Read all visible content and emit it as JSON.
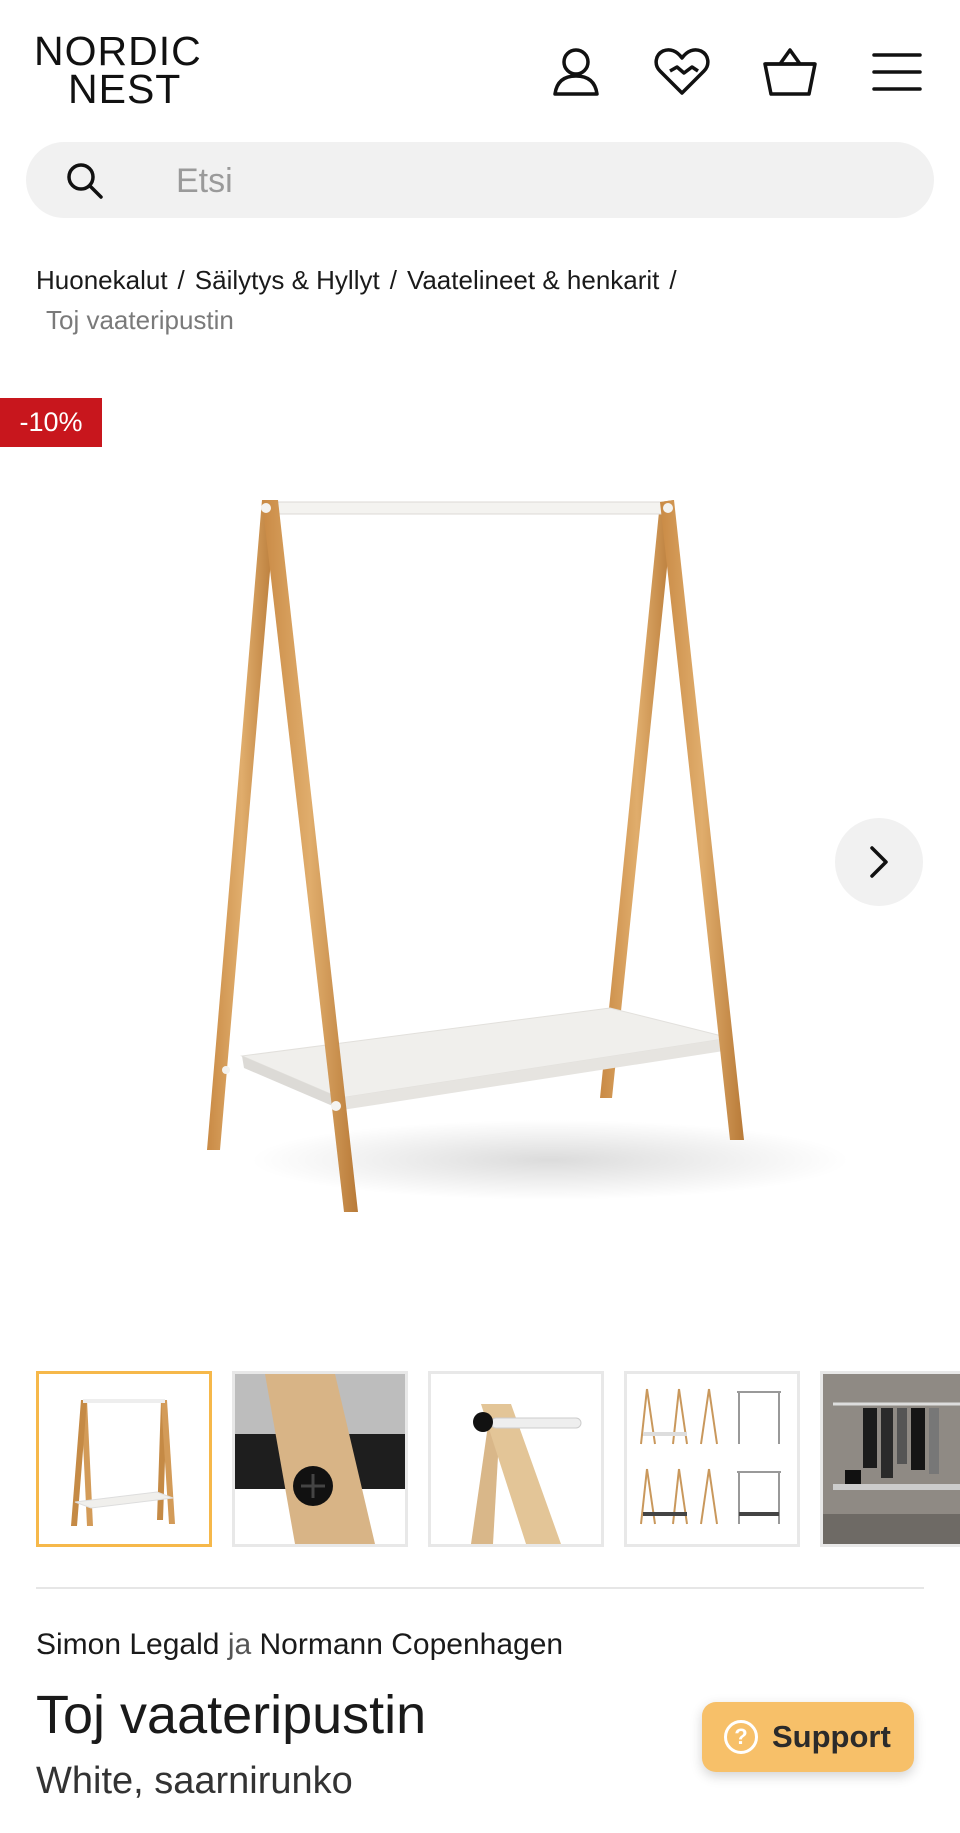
{
  "header": {
    "logo_line1": "NORDIC",
    "logo_line2": "NEST"
  },
  "search": {
    "placeholder": "Etsi"
  },
  "breadcrumb": {
    "items": [
      "Huonekalut",
      "Säilytys & Hyllyt",
      "Vaatelineet & henkarit"
    ],
    "separator": "/",
    "current": "Toj vaateripustin"
  },
  "badge": {
    "discount": "-10%"
  },
  "product": {
    "designer": "Simon Legald",
    "joiner": "ja",
    "brand": "Normann Copenhagen",
    "title": "Toj vaateripustin",
    "variant": "White, saarnirunko"
  },
  "support": {
    "label": "Support"
  },
  "colors": {
    "accent": "#f6b84a",
    "badge": "#c8161d",
    "support": "#f7c069"
  },
  "icons": [
    "account-icon",
    "wishlist-icon",
    "basket-icon",
    "menu-icon",
    "search-icon",
    "chevron-right-icon",
    "help-icon"
  ]
}
